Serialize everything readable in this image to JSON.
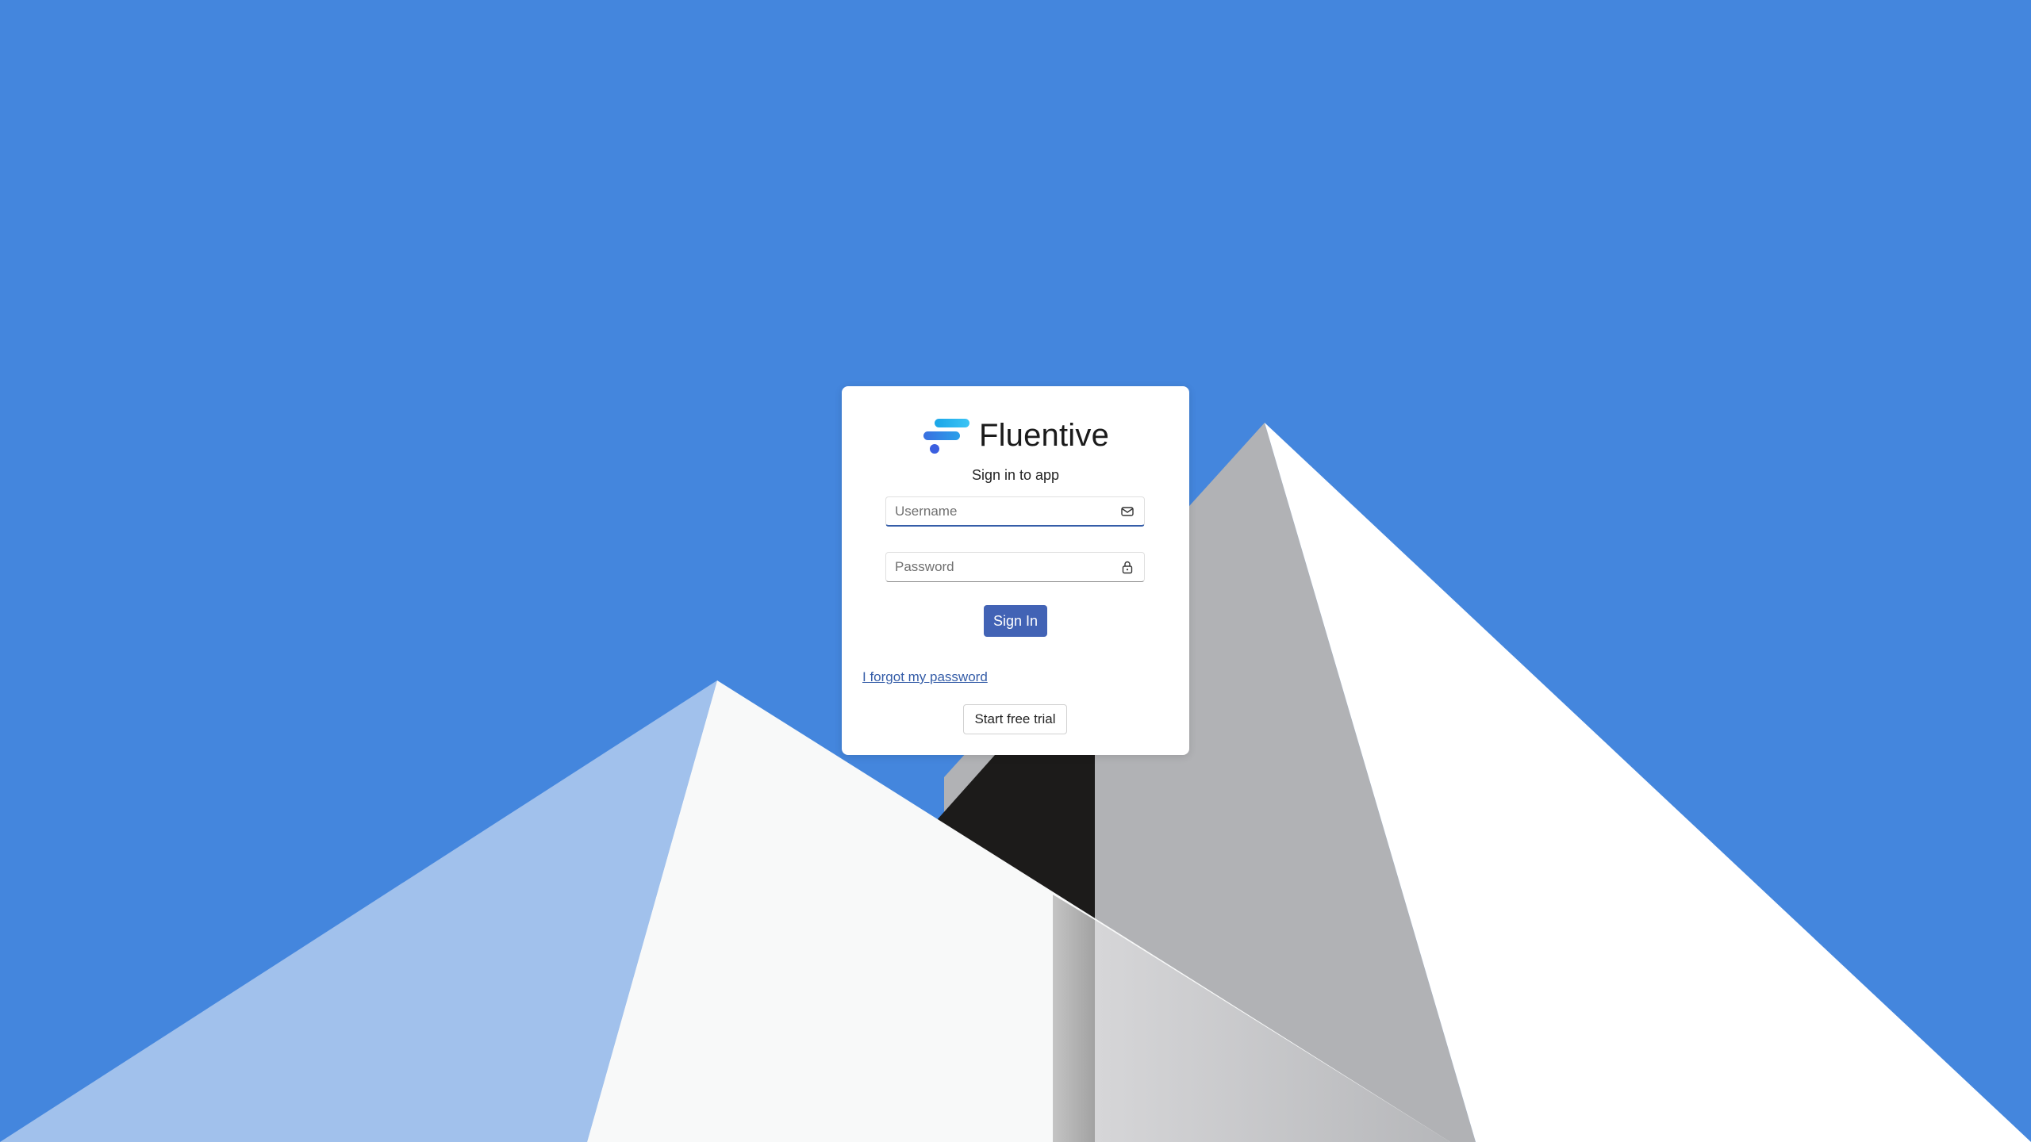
{
  "brand": {
    "name": "Fluentive",
    "logo_icon": "fluentive-logo-icon"
  },
  "login": {
    "subtitle": "Sign in to app",
    "username_placeholder": "Username",
    "username_value": "",
    "username_icon": "mail-icon",
    "password_placeholder": "Password",
    "password_value": "",
    "password_icon": "lock-icon",
    "signin_label": "Sign In",
    "forgot_label": "I forgot my password",
    "trial_label": "Start free trial"
  },
  "colors": {
    "background": "#4486dd",
    "primary_button": "#4263b5",
    "link": "#355da8"
  }
}
